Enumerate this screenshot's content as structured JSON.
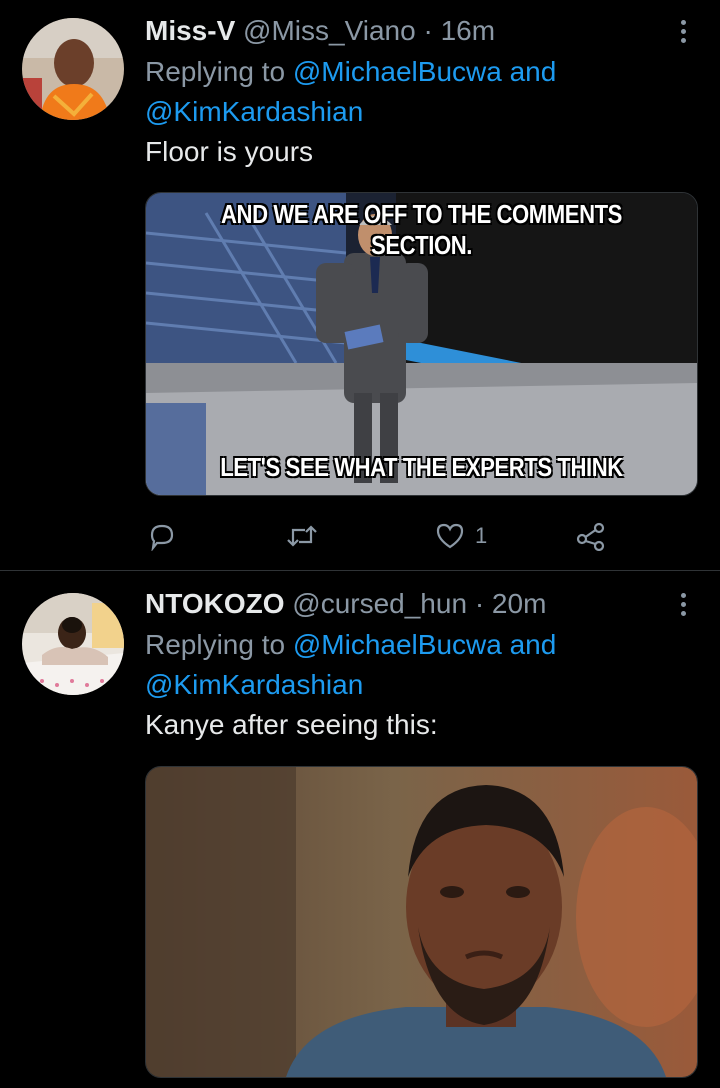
{
  "tweets": [
    {
      "name": "Miss-V",
      "handle": "@Miss_Viano",
      "separator": "·",
      "time": "16m",
      "replying_prefix": "Replying to",
      "mention1": "@MichaelBucwa",
      "and": "and",
      "mention2": "@KimKardashian",
      "text": "Floor is yours",
      "media_top_caption": "AND WE ARE OFF TO THE COMMENTS SECTION.",
      "media_bottom_caption": "LET'S SEE WHAT THE EXPERTS THINK",
      "actions": {
        "reply_icon": "reply-icon",
        "retweet_icon": "retweet-icon",
        "like_icon": "heart-icon",
        "like_count": "1",
        "share_icon": "share-icon"
      }
    },
    {
      "name": "NTOKOZO",
      "handle": "@cursed_hun",
      "separator": "·",
      "time": "20m",
      "replying_prefix": "Replying to",
      "mention1": "@MichaelBucwa",
      "and": "and",
      "mention2": "@KimKardashian",
      "text": "Kanye after seeing this:"
    }
  ],
  "colors": {
    "background": "#000000",
    "link": "#1d9bf0",
    "muted": "#8b98a5",
    "text": "#e7e9ea"
  }
}
